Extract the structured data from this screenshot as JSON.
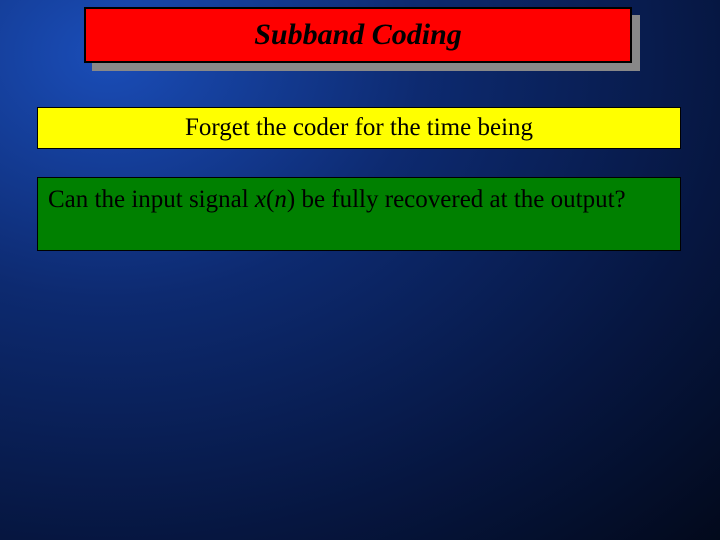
{
  "title": "Subband Coding",
  "yellow": "Forget the coder for the time being",
  "green": {
    "pre": "Can the input signal ",
    "x": "x",
    "paren_l": "(",
    "n": "n",
    "paren_r": ")",
    "post": " be fully recovered at the output?"
  }
}
